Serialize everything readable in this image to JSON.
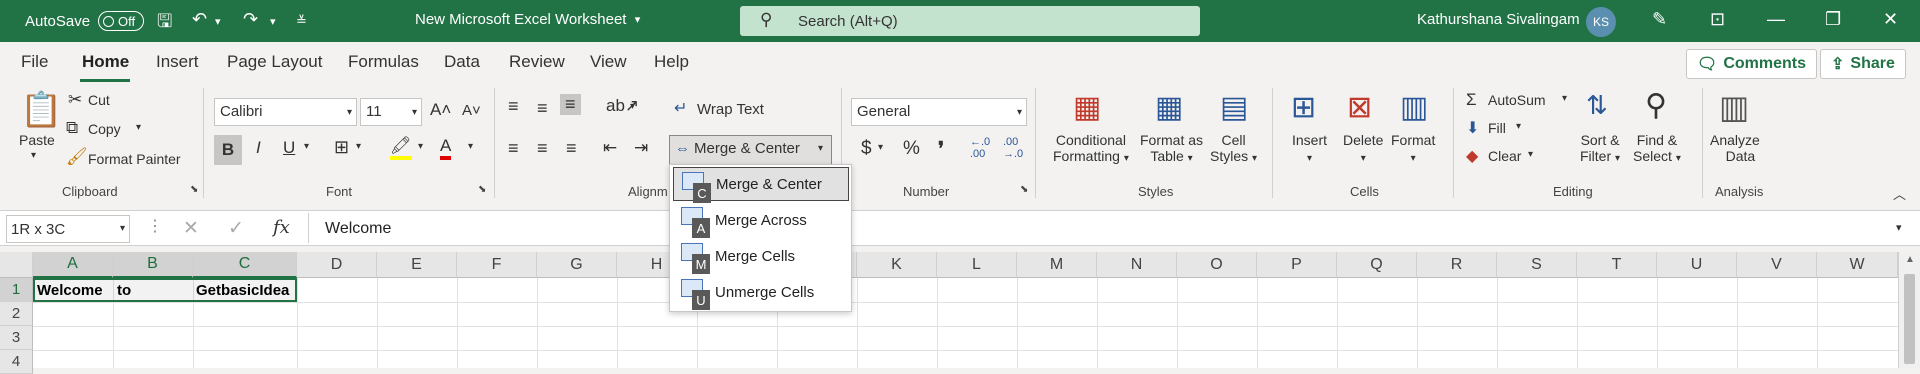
{
  "titlebar": {
    "autosave_label": "AutoSave",
    "autosave_state": "Off",
    "doc_title": "New Microsoft Excel Worksheet",
    "search_placeholder": "Search (Alt+Q)",
    "user_name": "Kathurshana Sivalingam",
    "user_initials": "KS"
  },
  "menu": {
    "items": [
      "File",
      "Home",
      "Insert",
      "Page Layout",
      "Formulas",
      "Data",
      "Review",
      "View",
      "Help"
    ],
    "active": "Home",
    "comments_label": "Comments",
    "share_label": "Share"
  },
  "ribbon": {
    "clipboard": {
      "paste": "Paste",
      "cut": "Cut",
      "copy": "Copy",
      "format_painter": "Format Painter",
      "group": "Clipboard"
    },
    "font": {
      "family": "Calibri",
      "size": "11",
      "bold": "B",
      "italic": "I",
      "underline": "U",
      "group": "Font"
    },
    "alignment": {
      "wrap_text": "Wrap Text",
      "merge_center": "Merge & Center",
      "group": "Alignm"
    },
    "number": {
      "format": "General",
      "group": "Number",
      "currency": "$",
      "percent": "%",
      "comma": "❜",
      "inc_decimal": "←.0\n.00",
      "dec_decimal": ".00\n→.0"
    },
    "styles": {
      "conditional": "Conditional",
      "formatting": "Formatting",
      "format_as": "Format as",
      "table": "Table",
      "cell": "Cell",
      "cell_styles": "Styles",
      "group": "Styles"
    },
    "cells": {
      "insert": "Insert",
      "delete": "Delete",
      "format": "Format",
      "group": "Cells"
    },
    "editing": {
      "autosum": "AutoSum",
      "fill": "Fill",
      "clear": "Clear",
      "sort": "Sort &",
      "filter": "Filter",
      "find": "Find &",
      "select": "Select",
      "group": "Editing"
    },
    "analysis": {
      "analyze": "Analyze",
      "data": "Data",
      "group": "Analysis"
    }
  },
  "formula_bar": {
    "name_box": "1R x 3C",
    "content": "Welcome",
    "fx": "fx"
  },
  "grid": {
    "columns": [
      "A",
      "B",
      "C",
      "D",
      "E",
      "F",
      "G",
      "H",
      "I",
      "J",
      "K",
      "L",
      "M",
      "N",
      "O",
      "P",
      "Q",
      "R",
      "S",
      "T",
      "U",
      "V",
      "W"
    ],
    "rows": [
      "1",
      "2",
      "3",
      "4"
    ],
    "cells": {
      "A1": "Welcome",
      "B1": "to",
      "C1": "GetbasicIdea"
    }
  },
  "merge_menu": {
    "items": [
      {
        "label": "Merge & Center",
        "key": "C"
      },
      {
        "label": "Merge Across",
        "key": "A"
      },
      {
        "label": "Merge Cells",
        "key": "M"
      },
      {
        "label": "Unmerge Cells",
        "key": "U"
      }
    ]
  }
}
